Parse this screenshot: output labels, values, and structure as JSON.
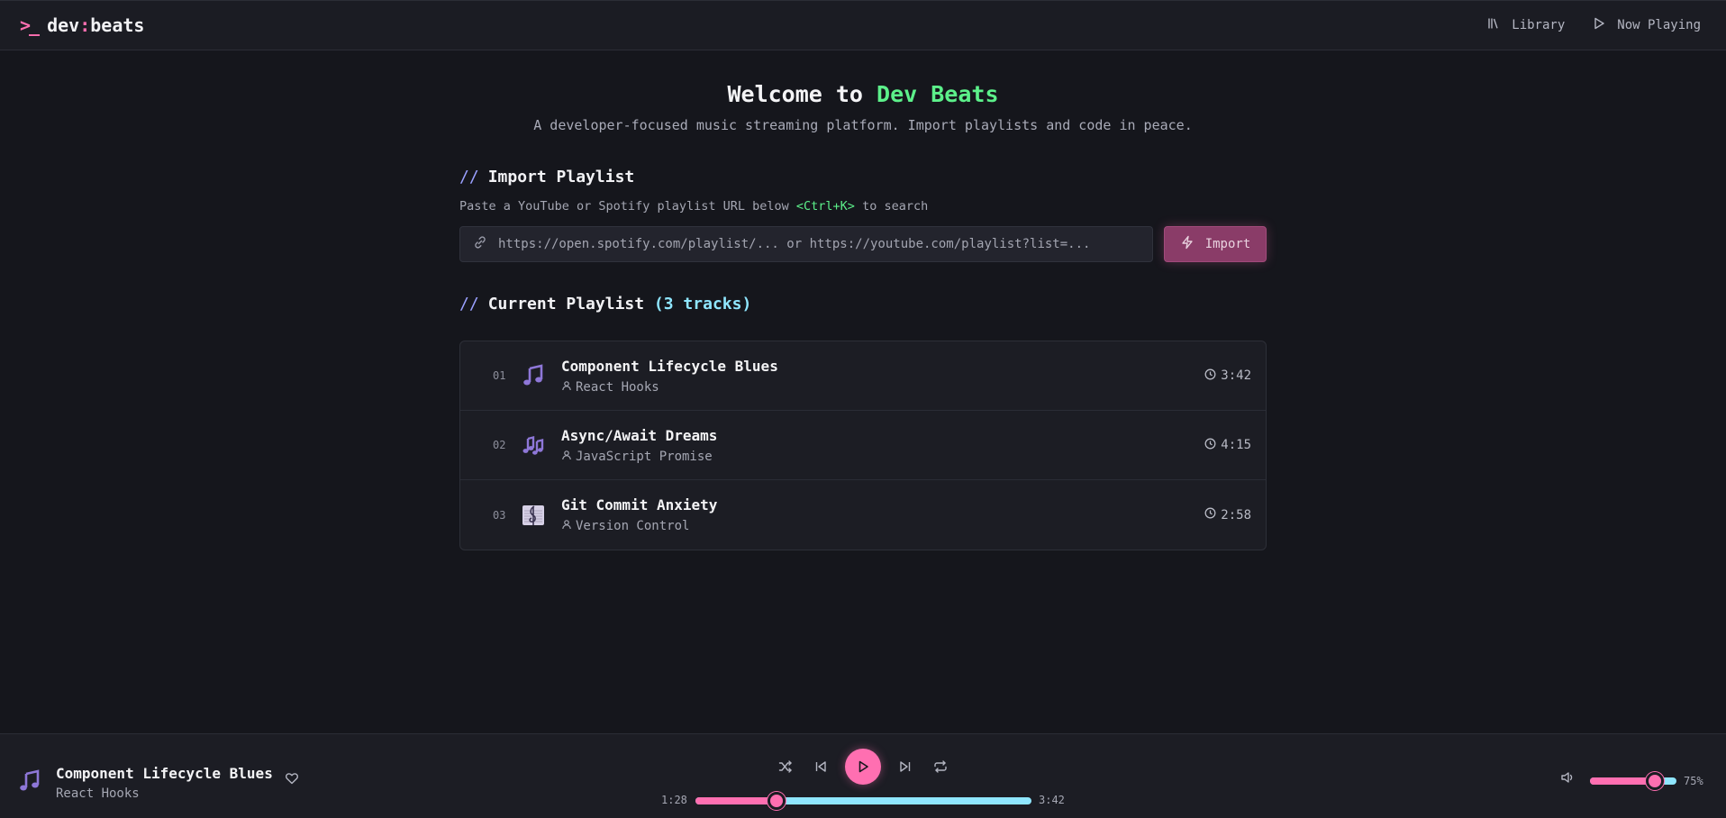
{
  "header": {
    "logo_glyph": ">_",
    "brand_prefix": "dev",
    "brand_separator": ":",
    "brand_suffix": "beats",
    "nav": [
      {
        "label": "Library",
        "icon": "library-icon"
      },
      {
        "label": "Now Playing",
        "icon": "play-outline-icon"
      }
    ]
  },
  "hero": {
    "title_prefix": "Welcome to",
    "title_accent": "Dev Beats",
    "subtitle": "A developer-focused music streaming platform. Import playlists and code in peace."
  },
  "import": {
    "slashes": "//",
    "heading": "Import Playlist",
    "hint_prefix": "Paste a YouTube or Spotify playlist URL below",
    "hint_shortcut": "<Ctrl+K>",
    "hint_suffix": "to search",
    "placeholder": "https://open.spotify.com/playlist/... or https://youtube.com/playlist?list=...",
    "button_label": "Import"
  },
  "playlist": {
    "slashes": "//",
    "heading": "Current Playlist",
    "count_label": "(3 tracks)",
    "tracks": [
      {
        "num": "01",
        "title": "Component Lifecycle Blues",
        "artist": "React Hooks",
        "duration": "3:42",
        "icon": "music-note-icon"
      },
      {
        "num": "02",
        "title": "Async/Await Dreams",
        "artist": "JavaScript Promise",
        "duration": "4:15",
        "icon": "music-notes-icon"
      },
      {
        "num": "03",
        "title": "Git Commit Anxiety",
        "artist": "Version Control",
        "duration": "2:58",
        "icon": "musical-score-icon"
      }
    ]
  },
  "player": {
    "title": "Component Lifecycle Blues",
    "artist": "React Hooks",
    "current_time": "1:28",
    "total_time": "3:42",
    "progress_fraction": 0.24,
    "volume_percent": 75,
    "volume_label": "75%"
  },
  "colors": {
    "accent_pink": "#ff6fb1",
    "accent_green": "#5cf08a",
    "accent_cyan": "#8fe6ff",
    "background": "#15161c"
  }
}
